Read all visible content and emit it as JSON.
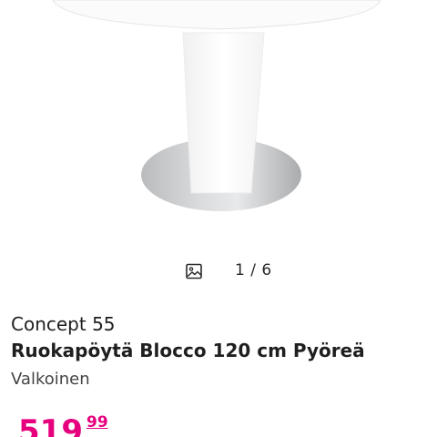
{
  "gallery": {
    "icon": "image-gallery-icon",
    "page_indicator": "1 / 6"
  },
  "product": {
    "brand": "Concept 55",
    "title": "Ruokapöytä Blocco 120 cm Pyöreä",
    "variant": "Valkoinen",
    "price_main": "519",
    "price_cents": "99",
    "price_color": "#e6007e"
  }
}
